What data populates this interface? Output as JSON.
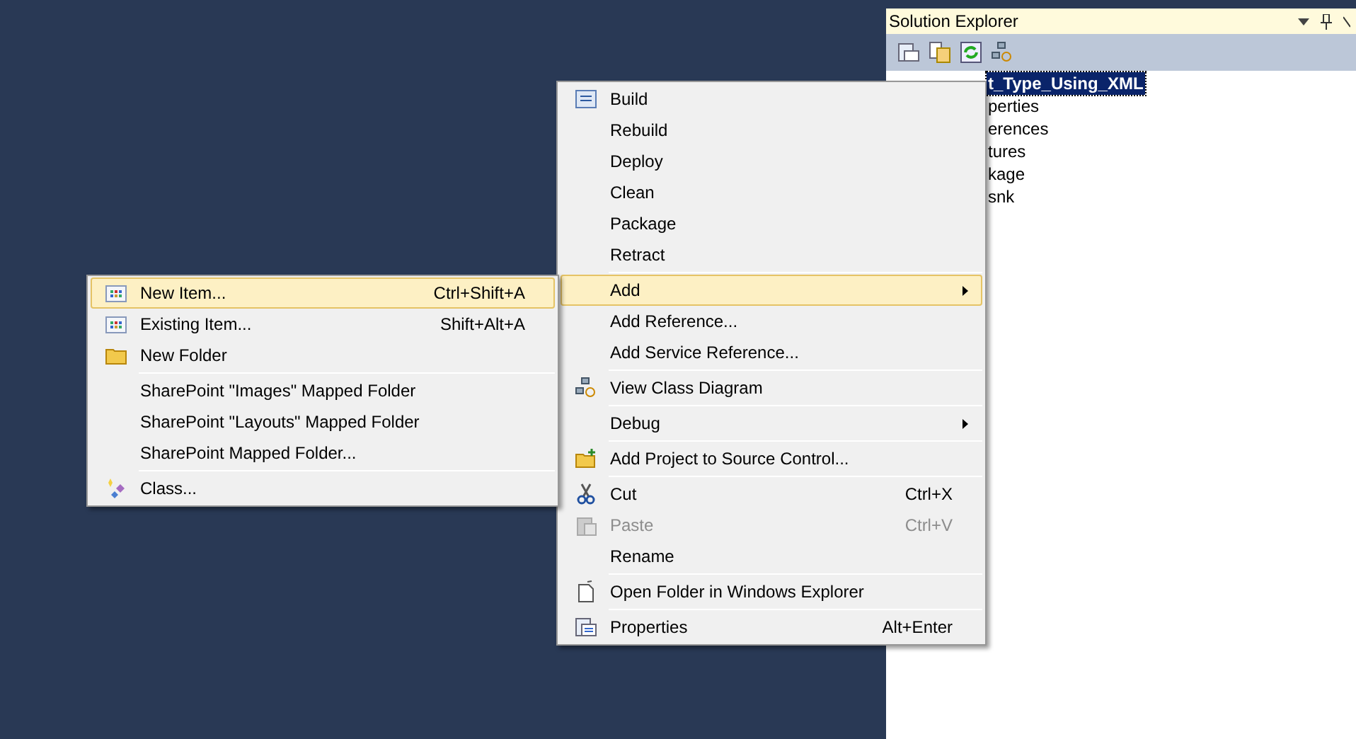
{
  "solution_explorer": {
    "title": "Solution Explorer",
    "tree": [
      {
        "label": "t_Type_Using_XML",
        "selected": true
      },
      {
        "label": "perties",
        "selected": false
      },
      {
        "label": "erences",
        "selected": false
      },
      {
        "label": "tures",
        "selected": false
      },
      {
        "label": "kage",
        "selected": false
      },
      {
        "label": "snk",
        "selected": false
      }
    ]
  },
  "context_menu": [
    {
      "kind": "item",
      "label": "Build"
    },
    {
      "kind": "item",
      "label": "Rebuild"
    },
    {
      "kind": "item",
      "label": "Deploy"
    },
    {
      "kind": "item",
      "label": "Clean"
    },
    {
      "kind": "item",
      "label": "Package"
    },
    {
      "kind": "item",
      "label": "Retract"
    },
    {
      "kind": "separator"
    },
    {
      "kind": "submenu",
      "label": "Add",
      "selected": true
    },
    {
      "kind": "item",
      "label": "Add Reference..."
    },
    {
      "kind": "item",
      "label": "Add Service Reference..."
    },
    {
      "kind": "separator"
    },
    {
      "kind": "item",
      "label": "View Class Diagram"
    },
    {
      "kind": "separator"
    },
    {
      "kind": "submenu",
      "label": "Debug",
      "selected": false
    },
    {
      "kind": "separator"
    },
    {
      "kind": "item",
      "label": "Add Project to Source Control..."
    },
    {
      "kind": "separator"
    },
    {
      "kind": "item",
      "label": "Cut",
      "shortcut": "Ctrl+X"
    },
    {
      "kind": "item",
      "label": "Paste",
      "shortcut": "Ctrl+V",
      "disabled": true
    },
    {
      "kind": "item",
      "label": "Rename"
    },
    {
      "kind": "separator"
    },
    {
      "kind": "item",
      "label": "Open Folder in Windows Explorer"
    },
    {
      "kind": "separator"
    },
    {
      "kind": "item",
      "label": "Properties",
      "shortcut": "Alt+Enter"
    }
  ],
  "add_submenu": [
    {
      "kind": "item",
      "label": "New Item...",
      "shortcut": "Ctrl+Shift+A",
      "selected": true
    },
    {
      "kind": "item",
      "label": "Existing Item...",
      "shortcut": "Shift+Alt+A",
      "selected": false
    },
    {
      "kind": "item",
      "label": "New Folder",
      "selected": false
    },
    {
      "kind": "separator"
    },
    {
      "kind": "item",
      "label": "SharePoint \"Images\" Mapped Folder",
      "selected": false
    },
    {
      "kind": "item",
      "label": "SharePoint \"Layouts\" Mapped Folder",
      "selected": false
    },
    {
      "kind": "item",
      "label": "SharePoint Mapped Folder...",
      "selected": false
    },
    {
      "kind": "separator"
    },
    {
      "kind": "item",
      "label": "Class...",
      "selected": false
    }
  ]
}
